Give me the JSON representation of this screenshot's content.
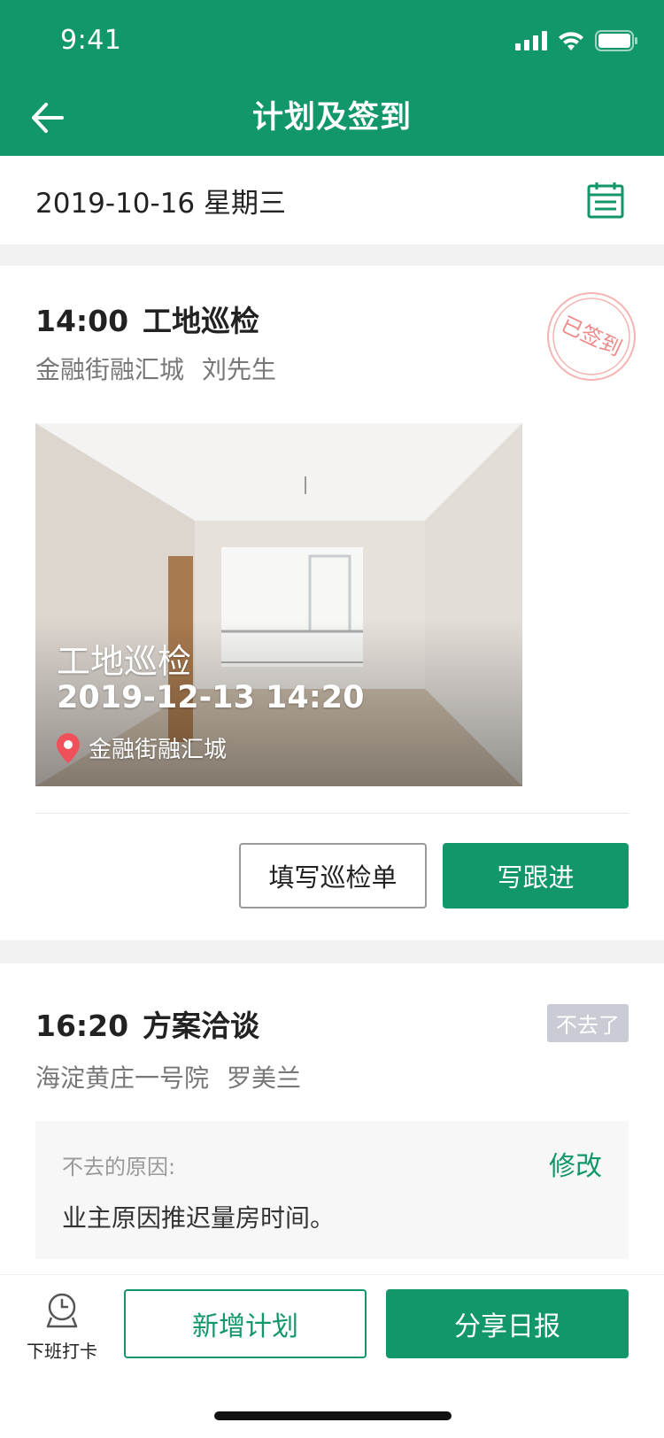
{
  "status": {
    "time": "9:41"
  },
  "nav": {
    "title": "计划及签到"
  },
  "date_bar": {
    "date": "2019-10-16 星期三"
  },
  "plans": [
    {
      "time": "14:00",
      "title": "工地巡检",
      "location": "金融街融汇城",
      "contact": "刘先生",
      "stamp": "已签到",
      "photo": {
        "title": "工地巡检",
        "datetime": "2019-12-13  14:20",
        "location": "金融街融汇城"
      },
      "buttons": {
        "fill_form": "填写巡检单",
        "follow_up": "写跟进"
      }
    },
    {
      "time": "16:20",
      "title": "方案洽谈",
      "location": "海淀黄庄一号院",
      "contact": "罗美兰",
      "status_tag": "不去了",
      "reason": {
        "label": "不去的原因:",
        "edit": "修改",
        "text": "业主原因推迟量房时间。"
      }
    }
  ],
  "bottom": {
    "clockout": "下班打卡",
    "add_plan": "新增计划",
    "share_report": "分享日报"
  },
  "colors": {
    "primary": "#12976a",
    "stamp": "#f08a8a",
    "tag_gray": "#c9ccd4"
  }
}
